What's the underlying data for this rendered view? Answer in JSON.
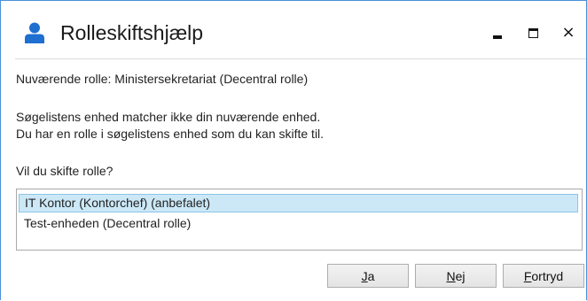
{
  "window": {
    "title": "Rolleskiftshjælp",
    "controls": {
      "minimize": "minimize",
      "maximize": "maximize",
      "close": "×"
    }
  },
  "content": {
    "current_role": "Nuværende rolle: Ministersekretariat (Decentral rolle)",
    "message_line_1": "Søgelistens enhed matcher ikke din nuværende enhed.",
    "message_line_2": "Du har en rolle i søgelistens enhed som du kan skifte til.",
    "question": "Vil du skifte rolle?"
  },
  "role_list": {
    "items": [
      {
        "label": "IT Kontor (Kontorchef) (anbefalet)",
        "selected": true
      },
      {
        "label": "Test-enheden (Decentral rolle)",
        "selected": false
      }
    ]
  },
  "buttons": {
    "yes": {
      "accel": "J",
      "rest": "a"
    },
    "no": {
      "accel": "N",
      "rest": "ej"
    },
    "cancel": {
      "accel": "F",
      "rest": "ortryd"
    }
  },
  "colors": {
    "window_border": "#4a90d9",
    "user_icon": "#1f6fd1",
    "selection_bg": "#cce8f7",
    "selection_border": "#8cc4e6"
  },
  "icons": {
    "title": "user-icon"
  }
}
